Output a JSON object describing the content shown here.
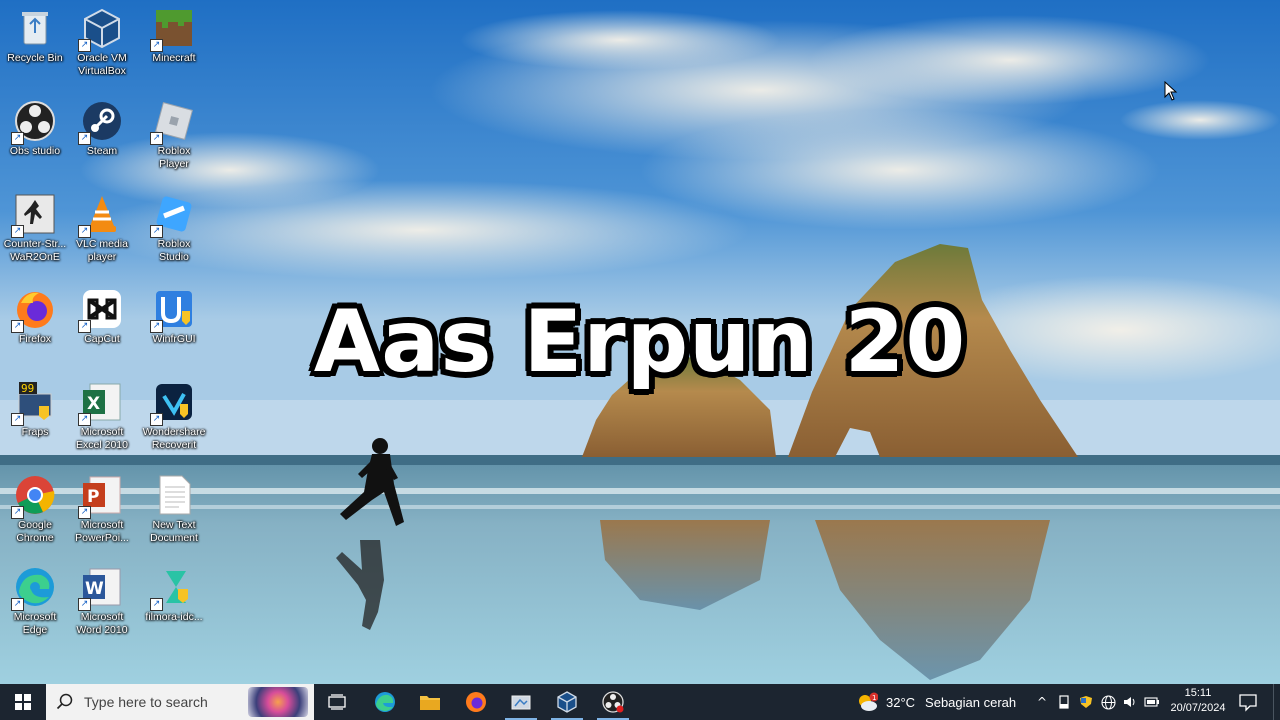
{
  "overlay": {
    "title": "Aas Erpun 20"
  },
  "desktop": {
    "icons": [
      {
        "label": "Recycle Bin",
        "icon": "recycle-bin-icon"
      },
      {
        "label": "Oracle VM\nVirtualBox",
        "icon": "virtualbox-icon"
      },
      {
        "label": "Minecraft",
        "icon": "minecraft-icon"
      },
      {
        "label": "Obs studio",
        "icon": "obs-studio-icon"
      },
      {
        "label": "Steam",
        "icon": "steam-icon"
      },
      {
        "label": "Roblox\nPlayer",
        "icon": "roblox-player-icon"
      },
      {
        "label": "Counter-Str...\nWaR2OnE",
        "icon": "counter-strike-icon"
      },
      {
        "label": "VLC media\nplayer",
        "icon": "vlc-icon"
      },
      {
        "label": "Roblox\nStudio",
        "icon": "roblox-studio-icon"
      },
      {
        "label": "Firefox",
        "icon": "firefox-icon"
      },
      {
        "label": "CapCut",
        "icon": "capcut-icon"
      },
      {
        "label": "WinfrGUI",
        "icon": "winfrgui-icon"
      },
      {
        "label": "Fraps",
        "icon": "fraps-icon"
      },
      {
        "label": "Microsoft\nExcel 2010",
        "icon": "excel-icon"
      },
      {
        "label": "Wondershare\nRecoverit",
        "icon": "recoverit-icon"
      },
      {
        "label": "Google\nChrome",
        "icon": "chrome-icon"
      },
      {
        "label": "Microsoft\nPowerPoi...",
        "icon": "powerpoint-icon"
      },
      {
        "label": "New Text\nDocument",
        "icon": "text-document-icon"
      },
      {
        "label": "Microsoft\nEdge",
        "icon": "edge-icon"
      },
      {
        "label": "Microsoft\nWord 2010",
        "icon": "word-icon"
      },
      {
        "label": "filmora-idc...",
        "icon": "filmora-installer-icon"
      }
    ]
  },
  "taskbar": {
    "search_placeholder": "Type here to search",
    "pinned": [
      {
        "icon": "task-view-icon"
      },
      {
        "icon": "edge-icon"
      },
      {
        "icon": "file-explorer-icon"
      },
      {
        "icon": "firefox-icon"
      },
      {
        "icon": "screen-capture-icon"
      },
      {
        "icon": "virtualbox-icon"
      },
      {
        "icon": "obs-studio-icon"
      }
    ],
    "weather": {
      "temp": "32°C",
      "desc": "Sebagian cerah",
      "badge": "1"
    },
    "clock": {
      "time": "15:11",
      "date": "20/07/2024"
    },
    "colors": {
      "bar": "#1c2530",
      "search_bg": "#f2f2f2",
      "accent": "#0078d7"
    }
  }
}
